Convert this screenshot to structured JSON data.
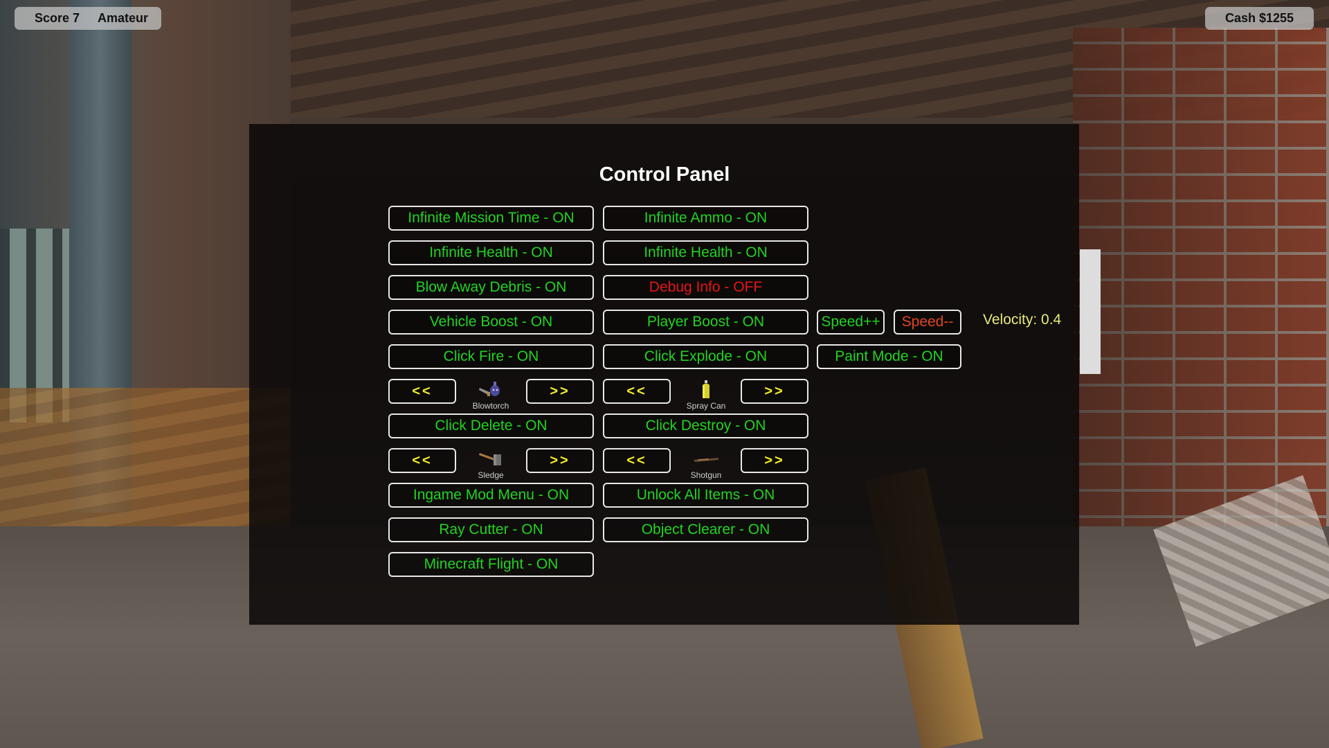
{
  "hud": {
    "score_label": "Score 7",
    "rank_label": "Amateur",
    "cash_label": "Cash $1255"
  },
  "panel": {
    "title": "Control Panel",
    "toggles": {
      "infinite_mission_time": {
        "label": "Infinite Mission Time - ON",
        "state": "on"
      },
      "infinite_ammo": {
        "label": "Infinite Ammo - ON",
        "state": "on"
      },
      "infinite_health_left": {
        "label": "Infinite Health - ON",
        "state": "on"
      },
      "infinite_health_right": {
        "label": "Infinite Health - ON",
        "state": "on"
      },
      "blow_away_debris": {
        "label": "Blow Away Debris - ON",
        "state": "on"
      },
      "debug_info": {
        "label": "Debug Info - OFF",
        "state": "off"
      },
      "vehicle_boost": {
        "label": "Vehicle Boost - ON",
        "state": "on"
      },
      "player_boost": {
        "label": "Player Boost - ON",
        "state": "on"
      },
      "click_fire": {
        "label": "Click Fire - ON",
        "state": "on"
      },
      "click_explode": {
        "label": "Click Explode - ON",
        "state": "on"
      },
      "paint_mode": {
        "label": "Paint Mode - ON",
        "state": "on"
      },
      "click_delete": {
        "label": "Click Delete - ON",
        "state": "on"
      },
      "click_destroy": {
        "label": "Click Destroy - ON",
        "state": "on"
      },
      "ingame_mod_menu": {
        "label": "Ingame Mod Menu - ON",
        "state": "on"
      },
      "unlock_all_items": {
        "label": "Unlock All Items - ON",
        "state": "on"
      },
      "ray_cutter": {
        "label": "Ray Cutter - ON",
        "state": "on"
      },
      "object_clearer": {
        "label": "Object Clearer - ON",
        "state": "on"
      },
      "minecraft_flight": {
        "label": "Minecraft Flight - ON",
        "state": "on"
      }
    },
    "speed": {
      "increase_label": "Speed++",
      "decrease_label": "Speed--",
      "velocity_label": "Velocity: 0.4"
    },
    "selectors": {
      "prev_label": "<<",
      "next_label": ">>",
      "tool_1": {
        "name": "Blowtorch",
        "icon": "blowtorch-icon"
      },
      "tool_2": {
        "name": "Spray Can",
        "icon": "spray-can-icon"
      },
      "tool_3": {
        "name": "Sledge",
        "icon": "sledge-icon"
      },
      "tool_4": {
        "name": "Shotgun",
        "icon": "shotgun-icon"
      }
    }
  },
  "colors": {
    "on": "#21d321",
    "off": "#e51616",
    "arrow": "#f2ee2a",
    "velocity": "#e8e87a",
    "speed_decrease": "#e2461f"
  }
}
